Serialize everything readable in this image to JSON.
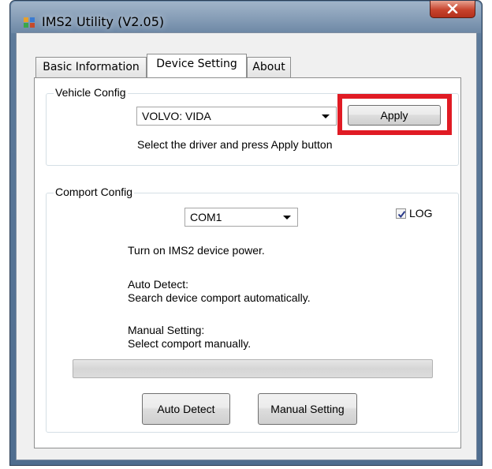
{
  "window": {
    "title": "IMS2 Utility (V2.05)"
  },
  "tabs": [
    {
      "label": "Basic Information",
      "active": false
    },
    {
      "label": "Device Setting",
      "active": true
    },
    {
      "label": "About",
      "active": false
    }
  ],
  "vehicle_config": {
    "legend": "Vehicle Config",
    "driver_select": {
      "value": "VOLVO: VIDA"
    },
    "apply_label": "Apply",
    "hint": "Select the driver and press Apply button"
  },
  "comport_config": {
    "legend": "Comport Config",
    "port_select": {
      "value": "COM1"
    },
    "log": {
      "label": "LOG",
      "checked": true
    },
    "power_text": "Turn on IMS2 device power.",
    "auto_title": "Auto Detect:",
    "auto_desc": "Search device comport automatically.",
    "manual_title": "Manual Setting:",
    "manual_desc": "Select comport manually.",
    "progress": 0,
    "auto_detect_label": "Auto Detect",
    "manual_setting_label": "Manual Setting"
  },
  "colors": {
    "highlight": "#e01b24",
    "titlebar": "#5d7a9a"
  },
  "icons": {
    "app": "app-icon",
    "close": "close-icon",
    "dropdown": "chevron-down-icon",
    "check": "check-icon"
  }
}
